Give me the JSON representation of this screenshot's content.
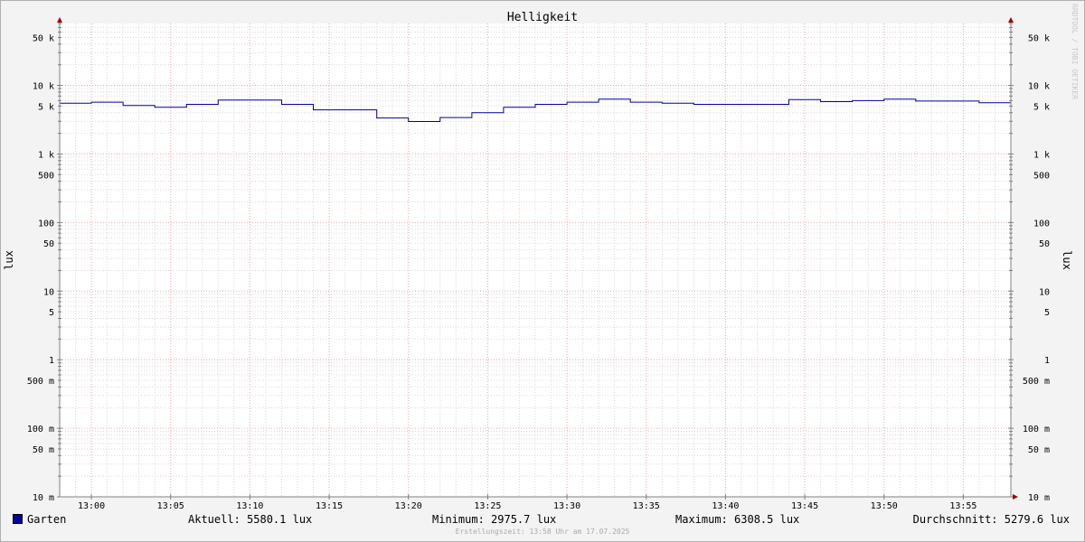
{
  "chart_data": {
    "type": "line",
    "title": "Helligkeit",
    "ylabel": "lux",
    "ylabel_right": "lux",
    "yscale": "log",
    "ylim": [
      0.01,
      80000
    ],
    "xlim": [
      "12:58",
      "13:58"
    ],
    "x_ticks": [
      "13:00",
      "13:05",
      "13:10",
      "13:15",
      "13:20",
      "13:25",
      "13:30",
      "13:35",
      "13:40",
      "13:45",
      "13:50",
      "13:55"
    ],
    "y_ticks": [
      {
        "value": 50000,
        "label": "50 k"
      },
      {
        "value": 10000,
        "label": "10 k"
      },
      {
        "value": 5000,
        "label": "5 k"
      },
      {
        "value": 1000,
        "label": "1 k"
      },
      {
        "value": 500,
        "label": "500"
      },
      {
        "value": 100,
        "label": "100"
      },
      {
        "value": 50,
        "label": "50"
      },
      {
        "value": 10,
        "label": "10"
      },
      {
        "value": 5,
        "label": "5"
      },
      {
        "value": 1,
        "label": "1"
      },
      {
        "value": 0.5,
        "label": "500 m"
      },
      {
        "value": 0.1,
        "label": "100 m"
      },
      {
        "value": 0.05,
        "label": "50 m"
      },
      {
        "value": 0.01,
        "label": "10 m"
      }
    ],
    "grid": true,
    "series": [
      {
        "name": "Garten",
        "color": "#0000a0",
        "x": [
          "12:58",
          "13:00",
          "13:02",
          "13:04",
          "13:06",
          "13:08",
          "13:10",
          "13:12",
          "13:14",
          "13:16",
          "13:18",
          "13:20",
          "13:22",
          "13:24",
          "13:26",
          "13:28",
          "13:30",
          "13:32",
          "13:34",
          "13:36",
          "13:38",
          "13:40",
          "13:42",
          "13:44",
          "13:46",
          "13:48",
          "13:50",
          "13:52",
          "13:54",
          "13:56"
        ],
        "values": [
          5500,
          5700,
          5100,
          4800,
          5300,
          6100,
          6100,
          5300,
          4400,
          4400,
          3350,
          2975.7,
          3400,
          4000,
          4800,
          5300,
          5700,
          6308.5,
          5700,
          5500,
          5300,
          5300,
          5300,
          6200,
          5800,
          6000,
          6300,
          5900,
          5900,
          5580.1
        ],
        "x_end": "13:58"
      }
    ]
  },
  "vendor_text": "RRDTOOL / TOBI OETIKER",
  "legend": {
    "series_name": "Garten",
    "aktuell": "Aktuell: 5580.1 lux",
    "minimum": "Minimum: 2975.7 lux",
    "maximum": "Maximum: 6308.5 lux",
    "durchschnitt": "Durchschnitt: 5279.6 lux"
  },
  "footer": "Erstellungszeit: 13:58 Uhr am 17.07.2025",
  "colors": {
    "series": "#0000a0",
    "major_grid": "#e8a8a8",
    "minor_grid": "#d8d8d8",
    "axis": "#808080",
    "arrow": "#a00000"
  }
}
